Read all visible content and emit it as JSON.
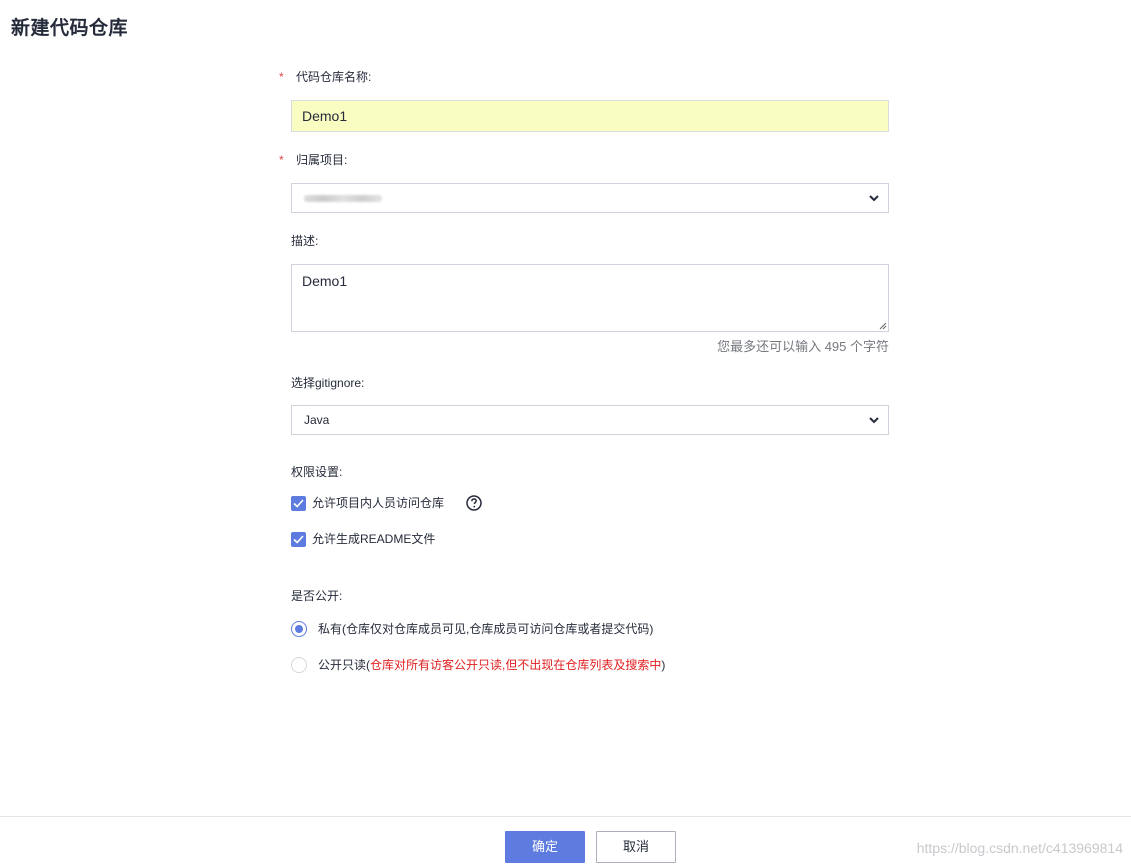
{
  "page": {
    "title": "新建代码仓库"
  },
  "form": {
    "repo_name": {
      "label": "代码仓库名称:",
      "required_mark": "*",
      "value": "Demo1"
    },
    "project": {
      "label": "归属项目:",
      "required_mark": "*",
      "value": "JenkinsTest"
    },
    "description": {
      "label": "描述:",
      "value": "Demo1",
      "counter": "您最多还可以输入 495 个字符"
    },
    "gitignore": {
      "label": "选择gitignore:",
      "value": "Java"
    },
    "permissions": {
      "label": "权限设置:",
      "options": [
        {
          "label": "允许项目内人员访问仓库",
          "checked": true
        },
        {
          "label": "允许生成README文件",
          "checked": true
        }
      ]
    },
    "visibility": {
      "label": "是否公开:",
      "private": {
        "label": "私有",
        "note": "(仓库仅对仓库成员可见,仓库成员可访问仓库或者提交代码)",
        "selected": true
      },
      "public_readonly": {
        "label": "公开只读",
        "note_open": "(",
        "note": "仓库对所有访客公开只读,但不出现在仓库列表及搜索中",
        "note_close": ")",
        "selected": false
      }
    }
  },
  "footer": {
    "confirm_label": "确定",
    "cancel_label": "取消"
  },
  "watermark": "https://blog.csdn.net/c413969814",
  "colors": {
    "primary": "#5e7ce0",
    "required": "#e54545",
    "warning_text": "#e02020",
    "highlight_input": "#fafdc2"
  },
  "icons": {
    "select_chevron": "chevron-down-icon",
    "help": "question-circle-icon",
    "check": "check-icon"
  }
}
